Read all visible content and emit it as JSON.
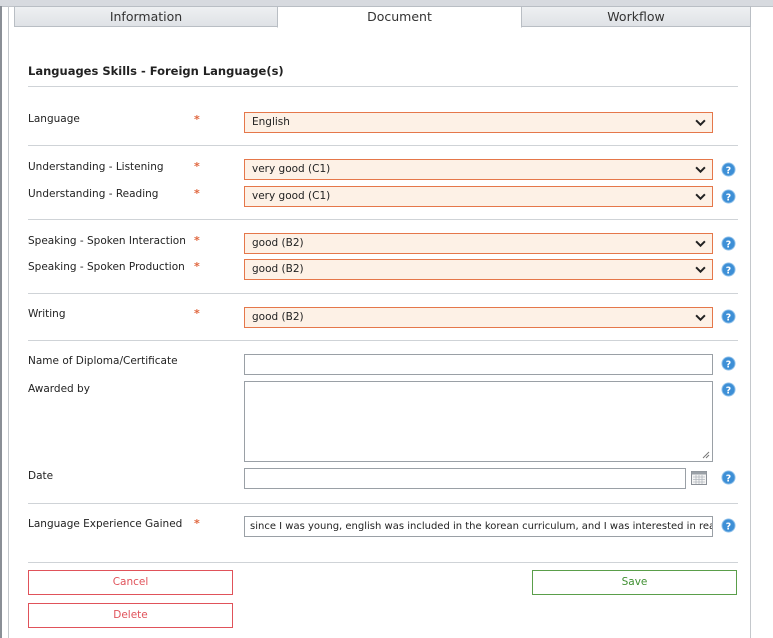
{
  "tabs": [
    {
      "label": "Information"
    },
    {
      "label": "Document"
    },
    {
      "label": "Workflow"
    }
  ],
  "section_title": "Languages Skills - Foreign Language(s)",
  "required_marker": "*",
  "fields": {
    "language": {
      "label": "Language",
      "value": "English"
    },
    "listening": {
      "label": "Understanding - Listening",
      "value": "very good (C1)"
    },
    "reading": {
      "label": "Understanding - Reading",
      "value": "very good (C1)"
    },
    "interaction": {
      "label": "Speaking - Spoken Interaction",
      "value": "good (B2)"
    },
    "production": {
      "label": "Speaking - Spoken Production",
      "value": "good (B2)"
    },
    "writing": {
      "label": "Writing",
      "value": "good (B2)"
    },
    "diploma": {
      "label": "Name of Diploma/Certificate",
      "value": ""
    },
    "awarded_by": {
      "label": "Awarded by",
      "value": ""
    },
    "date": {
      "label": "Date",
      "value": ""
    },
    "experience": {
      "label": "Language Experience Gained",
      "value": "since I was young, english was included in the korean curriculum, and I was interested in reac"
    }
  },
  "buttons": {
    "cancel": "Cancel",
    "delete": "Delete",
    "save": "Save"
  },
  "colors": {
    "required": "#e0663e",
    "select_border": "#e5774a",
    "select_bg": "#fdf1e6",
    "help_icon": "#3d8fd6",
    "danger": "#e0525a",
    "success": "#3f8f31"
  }
}
